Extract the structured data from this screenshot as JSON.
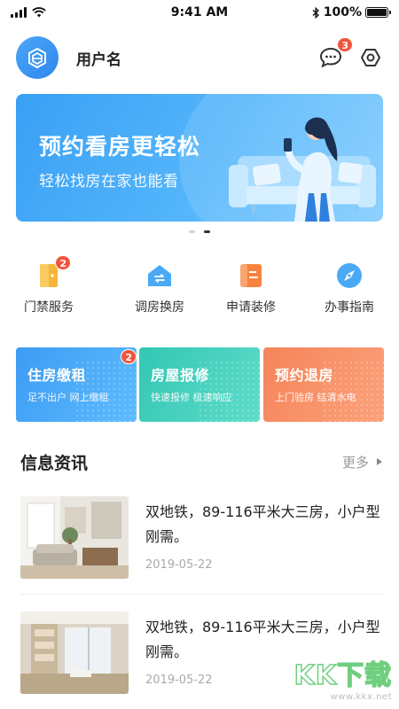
{
  "status_bar": {
    "time": "9:41 AM",
    "battery": "100%"
  },
  "header": {
    "username": "用户名",
    "message_count": "3"
  },
  "banner": {
    "title": "预约看房更轻松",
    "subtitle": "轻松找房在家也能看"
  },
  "services": [
    {
      "label": "门禁服务",
      "badge": "2",
      "icon": "door-card-icon",
      "color": "#f6b63a"
    },
    {
      "label": "调房换房",
      "badge": "",
      "icon": "house-swap-icon",
      "color": "#4aa9f5"
    },
    {
      "label": "申请装修",
      "badge": "",
      "icon": "renovation-icon",
      "color": "#f7833f"
    },
    {
      "label": "办事指南",
      "badge": "",
      "icon": "compass-icon",
      "color": "#4aa9f5"
    }
  ],
  "cards": [
    {
      "title": "住房缴租",
      "subtitle": "足不出户  网上缴租",
      "badge": "2"
    },
    {
      "title": "房屋报修",
      "subtitle": "快速报修  极速响应"
    },
    {
      "title": "预约退房",
      "subtitle": "上门验房  结清水电"
    }
  ],
  "news": {
    "title": "信息资讯",
    "more_label": "更多",
    "items": [
      {
        "title": "双地铁，89-116平米大三房，小户型刚需。",
        "date": "2019-05-22"
      },
      {
        "title": "双地铁，89-116平米大三房，小户型刚需。",
        "date": "2019-05-22"
      }
    ]
  },
  "watermark": {
    "text": "KK下载",
    "url": "www.kkx.net"
  },
  "colors": {
    "primary": "#3d9cf4",
    "teal": "#32c7b4",
    "orange": "#f6845a",
    "badge": "#f2553b"
  }
}
